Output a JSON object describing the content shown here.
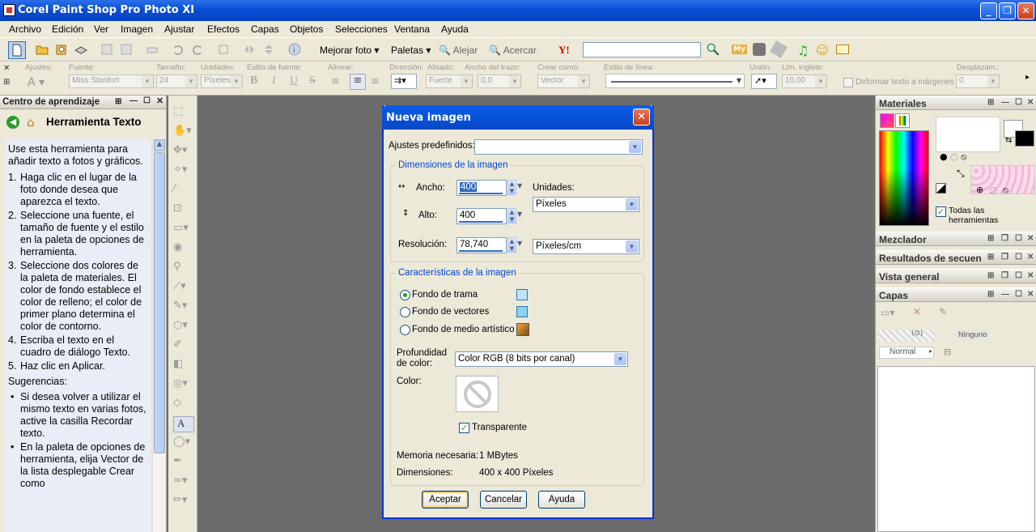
{
  "app": {
    "title": "Corel Paint Shop Pro Photo XI"
  },
  "menu": [
    "Archivo",
    "Edición",
    "Ver",
    "Imagen",
    "Ajustar",
    "Efectos",
    "Capas",
    "Objetos",
    "Selecciones",
    "Ventana",
    "Ayuda"
  ],
  "toolbar": {
    "mejorar": "Mejorar foto",
    "paletas": "Paletas",
    "alejar": "Alejar",
    "acercar": "Acercar",
    "yahoo": "Y!",
    "my": "My"
  },
  "options": {
    "ajustes_lbl": "Ajustes:",
    "fuente_lbl": "Fuente:",
    "fuente_val": "Miss Stanfort",
    "tamano_lbl": "Tamaño:",
    "tamano_val": "24",
    "unidades_lbl": "Unidades:",
    "unidades_val": "Píxeles",
    "estilo_lbl": "Estilo de fuente:",
    "alinear_lbl": "Alinear:",
    "direccion_lbl": "Dirección:",
    "alisado_lbl": "Alisado:",
    "alisado_val": "Fuerte",
    "ancho_lbl": "Ancho del trazo:",
    "ancho_val": "0,0",
    "crear_lbl": "Crear como:",
    "crear_val": "Vector",
    "estilolinea_lbl": "Estilo de línea:",
    "union_lbl": "Unión:",
    "lim_lbl": "Lím. inglete:",
    "lim_val": "10,00",
    "deformar": "Deformar texto a márgenes",
    "despl_lbl": "Desplazam.:",
    "despl_val": "0",
    "bold": "B",
    "italic": "I",
    "underline": "U",
    "strike": "S"
  },
  "learning": {
    "panel_title": "Centro de aprendizaje",
    "heading": "Herramienta Texto",
    "intro": "Use esta herramienta para añadir texto a fotos y gráficos.",
    "steps": [
      {
        "n": "1.",
        "t": "Haga clic en el lugar de la foto donde desea que aparezca el texto."
      },
      {
        "n": "2.",
        "t": "Seleccione una fuente, el tamaño de fuente y el estilo en la paleta de opciones de herramienta."
      },
      {
        "n": "3.",
        "t": "Seleccione dos colores de la paleta de materiales. El color de fondo establece el color de relleno; el color de primer plano determina el color de contorno."
      },
      {
        "n": "4.",
        "t": "Escriba el texto en el cuadro de diálogo Texto."
      },
      {
        "n": "5.",
        "t": "Haz clic en Aplicar."
      }
    ],
    "tips_title": "Sugerencias:",
    "tips": [
      "Si desea volver a utilizar el mismo texto en varias fotos, active la casilla Recordar texto.",
      "En la paleta de opciones de herramienta, elija Vector de la lista desplegable Crear como"
    ]
  },
  "tools": {
    "text_tool": "A"
  },
  "dialog": {
    "title": "Nueva imagen",
    "presets_lbl": "Ajustes predefinidos:",
    "presets_val": "",
    "dims_group": "Dimensiones de la imagen",
    "width_lbl": "Ancho:",
    "width_val": "400",
    "height_lbl": "Alto:",
    "height_val": "400",
    "units_lbl": "Unidades:",
    "units_val": "Píxeles",
    "res_lbl": "Resolución:",
    "res_val": "78,740",
    "res_units": "Píxeles/cm",
    "chars_group": "Características de la imagen",
    "raster": "Fondo de trama",
    "vector": "Fondo de vectores",
    "art": "Fondo de medio artístico",
    "depth_lbl": "Profundidad de color:",
    "depth_val": "Color RGB (8 bits por canal)",
    "color_lbl": "Color:",
    "transparent": "Transparente",
    "mem_lbl": "Memoria necesaria:",
    "mem_val": "1 MBytes",
    "dim_lbl": "Dimensiones:",
    "dim_val": "400 x 400 Píxeles",
    "ok": "Aceptar",
    "cancel": "Cancelar",
    "help": "Ayuda"
  },
  "right": {
    "materiales": "Materiales",
    "todas": "Todas las herramientas",
    "mezclador": "Mezclador",
    "resultados": "Resultados de secuen",
    "vista": "Vista general",
    "capas": "Capas",
    "ninguno": "Ninguno",
    "normal": "Normal"
  }
}
